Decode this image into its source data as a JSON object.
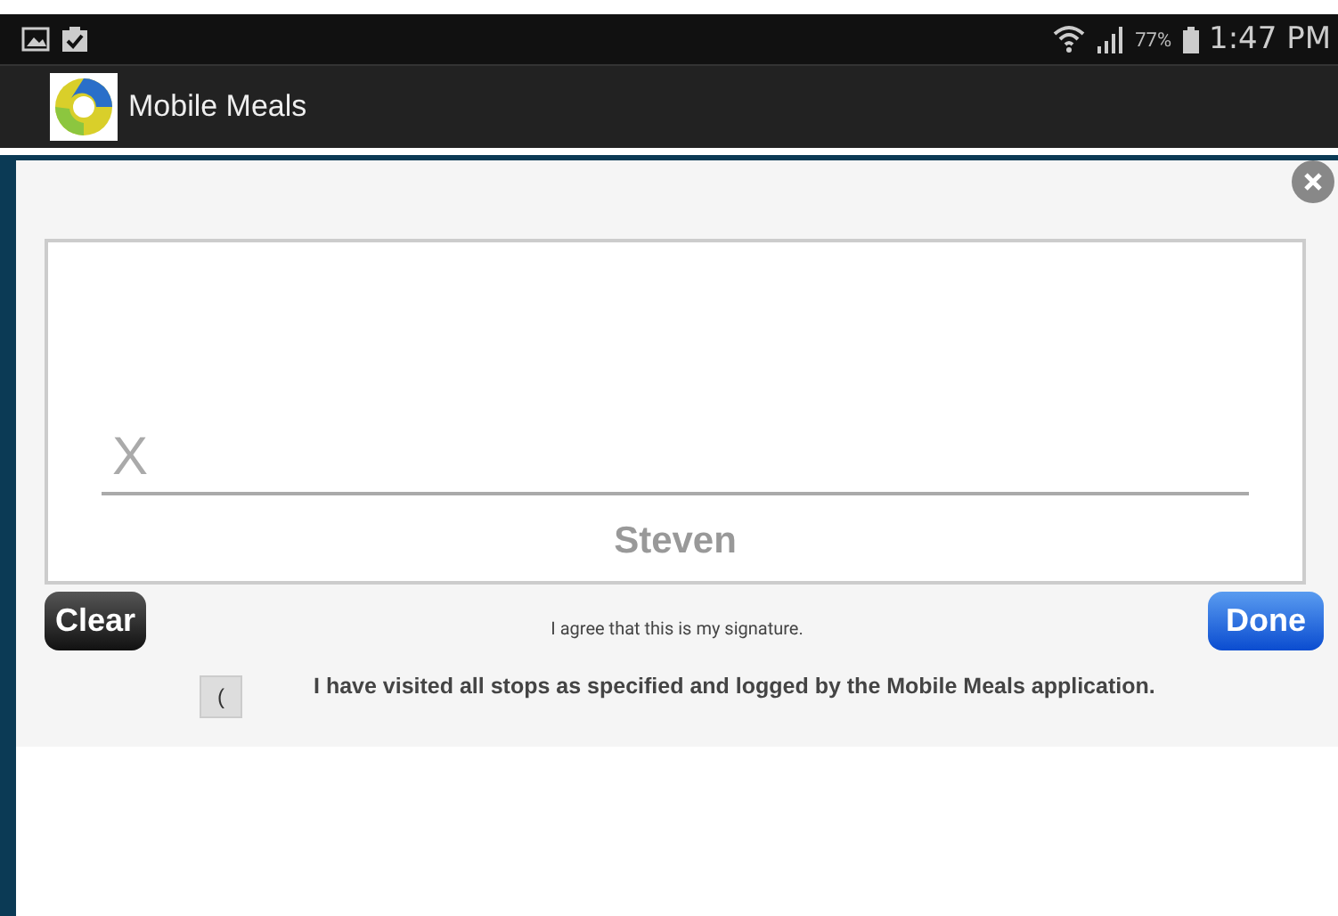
{
  "status_bar": {
    "battery_text": "77%",
    "time": "1:47 PM"
  },
  "app_bar": {
    "title": "Mobile Meals"
  },
  "signature_pad": {
    "mark": "X",
    "name": "Steven"
  },
  "buttons": {
    "clear": "Clear",
    "done": "Done"
  },
  "agreement": "I agree that this is my signature.",
  "confirmation": {
    "button_label": "(",
    "text": "I have visited all stops as specified and logged by the Mobile Meals application."
  }
}
